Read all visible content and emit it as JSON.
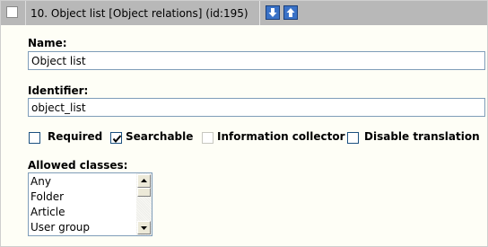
{
  "header": {
    "title": "10. Object list [Object relations] (id:195)",
    "move_down_icon": "arrow-down-icon",
    "move_up_icon": "arrow-up-icon"
  },
  "fields": {
    "name_label": "Name:",
    "name_value": "Object list",
    "identifier_label": "Identifier:",
    "identifier_value": "object_list"
  },
  "options": {
    "required": {
      "label": "Required",
      "checked": false
    },
    "searchable": {
      "label": "Searchable",
      "checked": true
    },
    "information_collector": {
      "label": "Information collector",
      "checked": false,
      "disabled": true
    },
    "disable_translation": {
      "label": "Disable translation",
      "checked": false
    }
  },
  "allowed_classes": {
    "label": "Allowed classes:",
    "items": [
      "Any",
      "Folder",
      "Article",
      "User group"
    ]
  },
  "colors": {
    "header_bg": "#b8b8b8",
    "panel_bg": "#fefef6",
    "arrow_button": "#3a72c7",
    "input_border": "#7f9db9"
  }
}
